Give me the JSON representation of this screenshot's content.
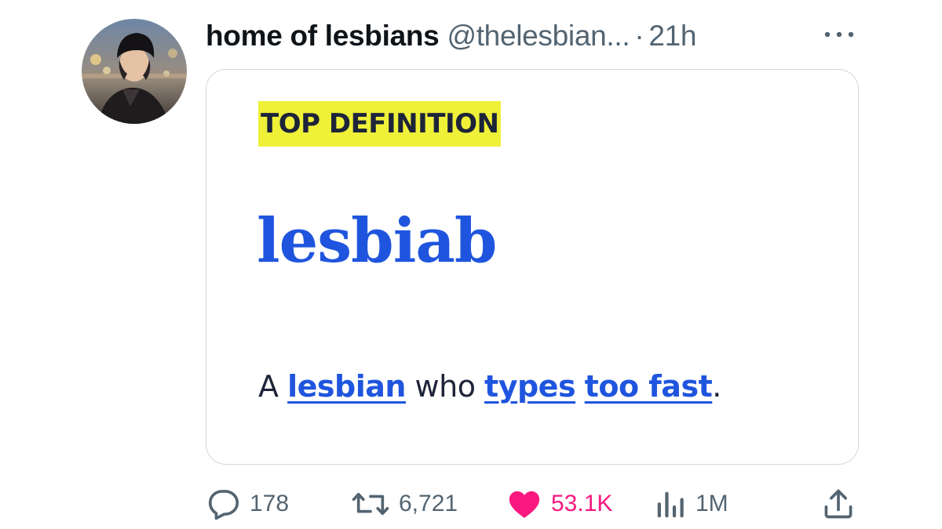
{
  "tweet": {
    "display_name": "home of lesbians",
    "handle": "@thelesbian...",
    "separator": "·",
    "time": "21h",
    "avatar": "user-avatar-photo",
    "more_icon": "more-horizontal-icon"
  },
  "card": {
    "badge": "TOP DEFINITION",
    "badge_color": "#eff138",
    "word": "lesbiab",
    "word_color": "#1f55de",
    "definition": {
      "prefix": "A",
      "link1": "lesbian",
      "middle": "who",
      "link2": "types",
      "link3": "too fast",
      "suffix": "."
    }
  },
  "actions": {
    "replies": {
      "icon": "reply-icon",
      "count": "178"
    },
    "retweets": {
      "icon": "retweet-icon",
      "count": "6,721"
    },
    "likes": {
      "icon": "heart-icon",
      "count": "53.1K",
      "color": "#f91880"
    },
    "views": {
      "icon": "views-chart-icon",
      "count": "1M"
    },
    "share": {
      "icon": "share-icon"
    }
  }
}
